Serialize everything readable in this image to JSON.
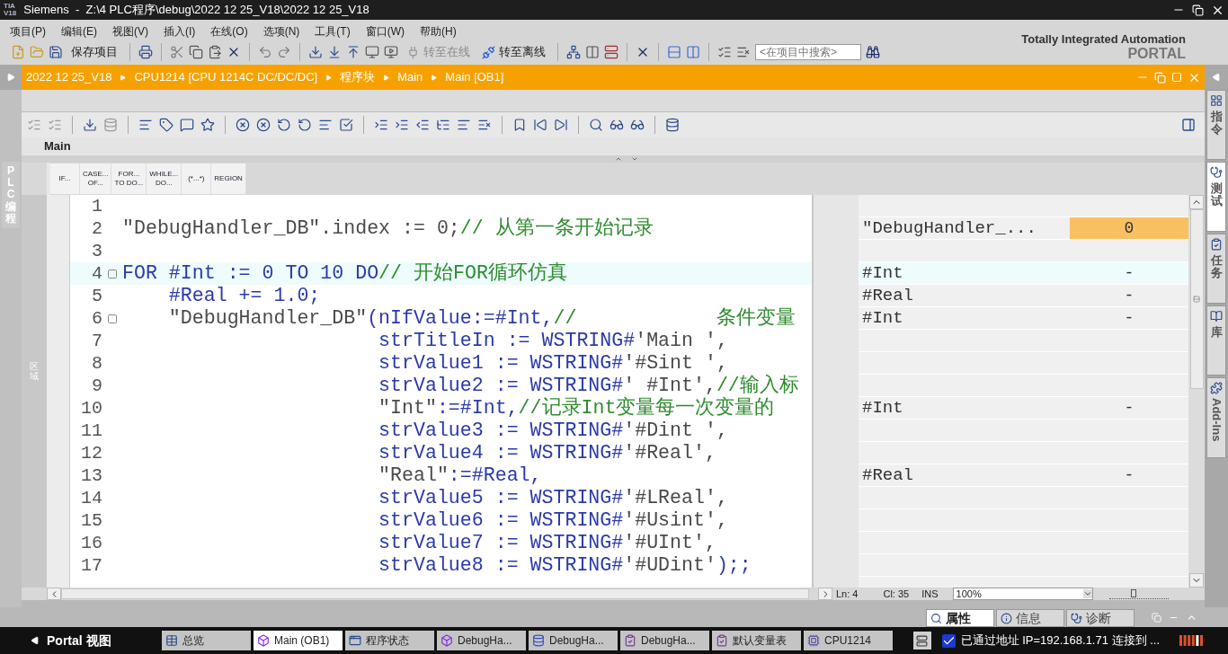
{
  "window": {
    "logo": [
      "TIA",
      "V18"
    ],
    "title": "Siemens  -  Z:\\4 PLC程序\\debug\\2022 12 25_V18\\2022 12 25_V18"
  },
  "menu": [
    "项目(P)",
    "编辑(E)",
    "视图(V)",
    "插入(I)",
    "在线(O)",
    "选项(N)",
    "工具(T)",
    "窗口(W)",
    "帮助(H)"
  ],
  "toolbar": {
    "save_label": "保存项目",
    "go_online": {
      "label": "转至在线",
      "disabled": true
    },
    "go_offline": {
      "label": "转至离线",
      "disabled": false
    },
    "search_placeholder": "<在项目中搜索>"
  },
  "brand": {
    "line1": "Totally Integrated Automation",
    "line2": "PORTAL"
  },
  "breadcrumb": [
    "2022 12 25_V18",
    "CPU1214 [CPU 1214C DC/DC/DC]",
    "程序块",
    "Main",
    "Main [OB1]"
  ],
  "left_tab": "PLC 编程",
  "region_label": "区域",
  "editor": {
    "title": "Main",
    "snippets": [
      "IF...",
      "CASE...\nOF...",
      "FOR...\nTO DO...",
      "WHILE...\nDO...",
      "(*...*)",
      "REGION"
    ],
    "lines": [
      {
        "number": "1",
        "fold": false,
        "current": false
      },
      {
        "number": "2",
        "fold": false,
        "current": false,
        "segments": [
          {
            "kind": "string",
            "text": "\"DebugHandler_DB\".index := 0;"
          },
          {
            "kind": "comment",
            "text": "// 从第一条开始记录"
          }
        ],
        "watch": {
          "name": "\"DebugHandler_...",
          "value": "0",
          "highlight": true
        }
      },
      {
        "number": "3",
        "fold": false,
        "current": false
      },
      {
        "number": "4",
        "fold": true,
        "current": true,
        "segments": [
          {
            "kind": "code",
            "text": "FOR #Int := 0 TO 10 DO"
          },
          {
            "kind": "comment",
            "text": "// 开始FOR循环仿真"
          }
        ],
        "watch": {
          "name": "#Int",
          "value": "-",
          "highlight": false
        }
      },
      {
        "number": "5",
        "fold": false,
        "current": false,
        "segments": [
          {
            "kind": "code",
            "text": "    #Real += 1.0;"
          }
        ],
        "watch": {
          "name": "#Real",
          "value": "-",
          "highlight": false
        }
      },
      {
        "number": "6",
        "fold": true,
        "current": false,
        "segments": [
          {
            "kind": "string",
            "text": "    \"DebugHandler_DB\""
          },
          {
            "kind": "code",
            "text": "(nIfValue:=#Int,"
          },
          {
            "kind": "comment",
            "text": "//            条件变量"
          }
        ],
        "watch": {
          "name": "#Int",
          "value": "-",
          "highlight": false
        }
      },
      {
        "number": "7",
        "fold": false,
        "current": false,
        "segments": [
          {
            "kind": "code",
            "text": "                      strTitleIn := WSTRING#"
          },
          {
            "kind": "string",
            "text": "'Main ',"
          }
        ]
      },
      {
        "number": "8",
        "fold": false,
        "current": false,
        "segments": [
          {
            "kind": "code",
            "text": "                      strValue1 := WSTRING#"
          },
          {
            "kind": "string",
            "text": "'#Sint ',"
          }
        ]
      },
      {
        "number": "9",
        "fold": false,
        "current": false,
        "segments": [
          {
            "kind": "code",
            "text": "                      strValue2 := WSTRING#"
          },
          {
            "kind": "string",
            "text": "' #Int',"
          },
          {
            "kind": "comment",
            "text": "//输入标"
          }
        ]
      },
      {
        "number": "10",
        "fold": false,
        "current": false,
        "segments": [
          {
            "kind": "string",
            "text": "                      \"Int\""
          },
          {
            "kind": "code",
            "text": ":=#Int,"
          },
          {
            "kind": "comment",
            "text": "//记录Int变量每一次变量的"
          }
        ],
        "watch": {
          "name": "#Int",
          "value": "-",
          "highlight": false
        }
      },
      {
        "number": "11",
        "fold": false,
        "current": false,
        "segments": [
          {
            "kind": "code",
            "text": "                      strValue3 := WSTRING#"
          },
          {
            "kind": "string",
            "text": "'#Dint ',"
          }
        ]
      },
      {
        "number": "12",
        "fold": false,
        "current": false,
        "segments": [
          {
            "kind": "code",
            "text": "                      strValue4 := WSTRING#"
          },
          {
            "kind": "string",
            "text": "'#Real',"
          }
        ]
      },
      {
        "number": "13",
        "fold": false,
        "current": false,
        "segments": [
          {
            "kind": "string",
            "text": "                      \"Real\""
          },
          {
            "kind": "code",
            "text": ":=#Real,"
          }
        ],
        "watch": {
          "name": "#Real",
          "value": "-",
          "highlight": false
        }
      },
      {
        "number": "14",
        "fold": false,
        "current": false,
        "segments": [
          {
            "kind": "code",
            "text": "                      strValue5 := WSTRING#"
          },
          {
            "kind": "string",
            "text": "'#LReal',"
          }
        ]
      },
      {
        "number": "15",
        "fold": false,
        "current": false,
        "segments": [
          {
            "kind": "code",
            "text": "                      strValue6 := WSTRING#"
          },
          {
            "kind": "string",
            "text": "'#Usint',"
          }
        ]
      },
      {
        "number": "16",
        "fold": false,
        "current": false,
        "segments": [
          {
            "kind": "code",
            "text": "                      strValue7 := WSTRING#"
          },
          {
            "kind": "string",
            "text": "'#UInt',"
          }
        ]
      },
      {
        "number": "17",
        "fold": false,
        "current": false,
        "segments": [
          {
            "kind": "code",
            "text": "                      strValue8 := WSTRING#"
          },
          {
            "kind": "string",
            "text": "'#UDint'"
          },
          {
            "kind": "code",
            "text": ");;"
          }
        ]
      }
    ]
  },
  "status": {
    "line": "Ln: 4",
    "column": "Cl: 35",
    "mode": "INS",
    "zoom": "100%",
    "zoom_slider": {
      "level": 0.4
    }
  },
  "side_tabs": [
    {
      "label": "指令",
      "selected": false
    },
    {
      "label": "测试",
      "selected": true
    },
    {
      "label": "任务",
      "selected": false
    },
    {
      "label": "库",
      "selected": false
    },
    {
      "label": "Add-Ins",
      "selected": false
    }
  ],
  "inspector_tabs": [
    {
      "label": "属性",
      "selected": true
    },
    {
      "label": "信息",
      "selected": false
    },
    {
      "label": "诊断",
      "selected": false
    }
  ],
  "taskbar": {
    "portal": "Portal 视图",
    "items": [
      {
        "label": "总览",
        "kind": "overview",
        "selected": false
      },
      {
        "label": "Main (OB1)",
        "kind": "block",
        "selected": true
      },
      {
        "label": "程序状态",
        "kind": "window",
        "selected": false
      },
      {
        "label": "DebugHa...",
        "kind": "block",
        "selected": false
      },
      {
        "label": "DebugHa...",
        "kind": "db",
        "selected": false
      },
      {
        "label": "DebugHa...",
        "kind": "table",
        "selected": false
      },
      {
        "label": "默认变量表",
        "kind": "table",
        "selected": false
      },
      {
        "label": "CPU1214",
        "kind": "device",
        "selected": false
      }
    ],
    "connection": "已通过地址 IP=192.168.1.71 连接到 ..."
  }
}
